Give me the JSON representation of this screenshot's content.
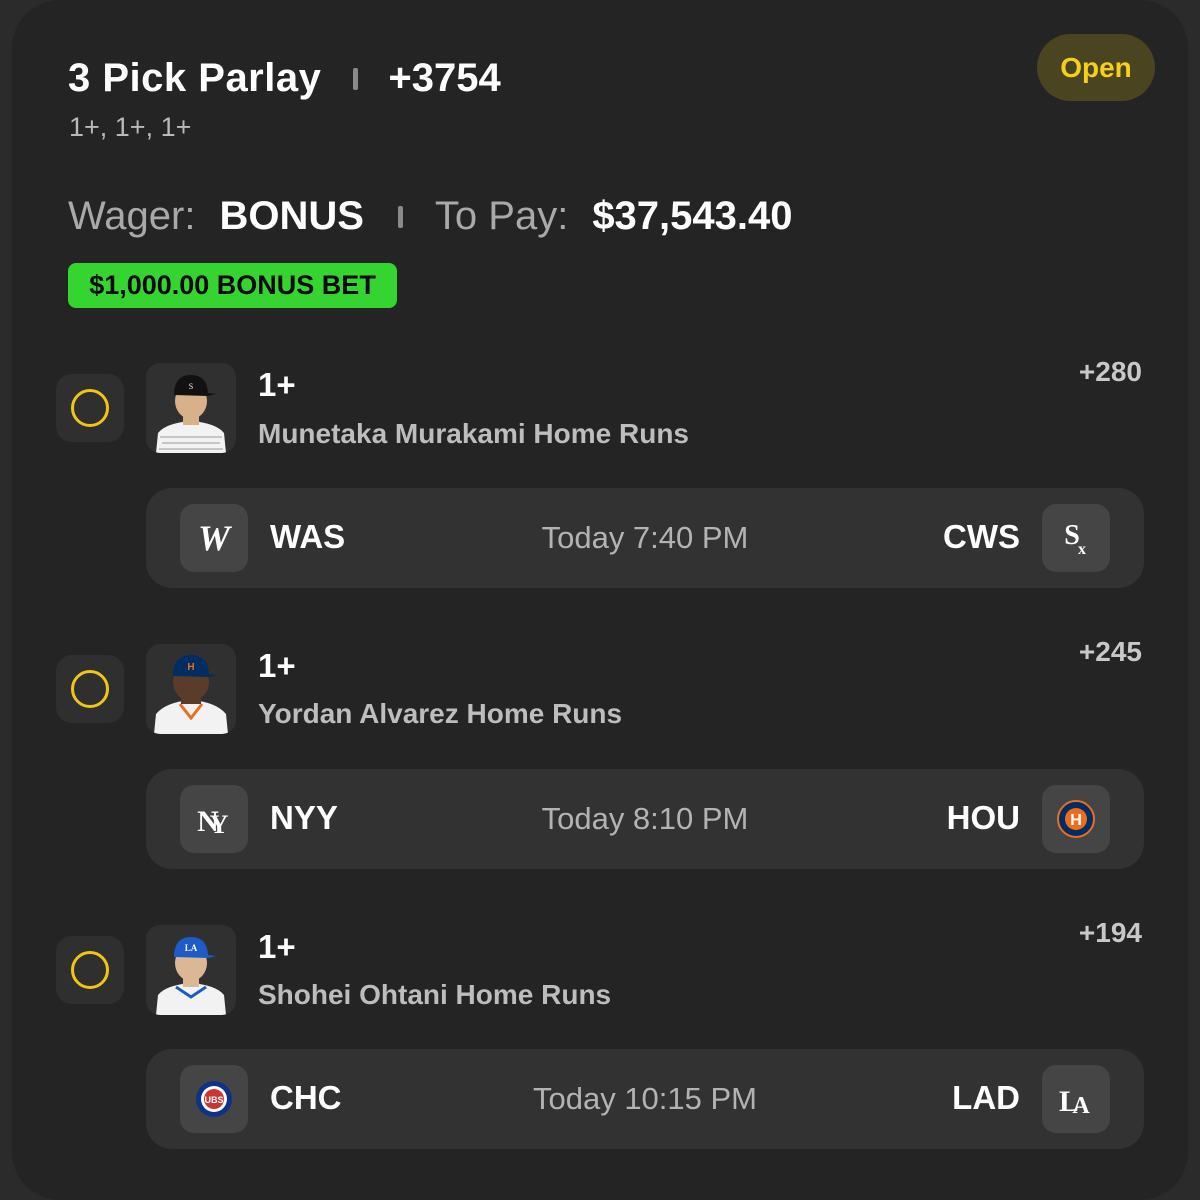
{
  "header": {
    "title": "3 Pick Parlay",
    "total_odds": "+3754",
    "subtitle": "1+, 1+, 1+",
    "status": "Open"
  },
  "wager": {
    "wager_label": "Wager:",
    "wager_value": "BONUS",
    "to_pay_label": "To Pay:",
    "to_pay_value": "$37,543.40",
    "bonus_badge": "$1,000.00 BONUS BET"
  },
  "legs": [
    {
      "line": "1+",
      "market": "Munetaka Murakami Home Runs",
      "odds": "+280",
      "away_team": "WAS",
      "home_team": "CWS",
      "time": "Today 7:40 PM",
      "away_logo_icon": "nationals-logo-icon",
      "home_logo_icon": "white-sox-logo-icon",
      "cap_color": "#111111",
      "jersey_color": "#f2f2f2",
      "skin_color": "#d8b089"
    },
    {
      "line": "1+",
      "market": "Yordan Alvarez Home Runs",
      "odds": "+245",
      "away_team": "NYY",
      "home_team": "HOU",
      "time": "Today 8:10 PM",
      "away_logo_icon": "yankees-logo-icon",
      "home_logo_icon": "astros-logo-icon",
      "cap_color": "#002d62",
      "jersey_color": "#f2f2f2",
      "skin_color": "#5b3b2a"
    },
    {
      "line": "1+",
      "market": "Shohei Ohtani Home Runs",
      "odds": "+194",
      "away_team": "CHC",
      "home_team": "LAD",
      "time": "Today 10:15 PM",
      "away_logo_icon": "cubs-logo-icon",
      "home_logo_icon": "dodgers-logo-icon",
      "cap_color": "#1e5bc6",
      "jersey_color": "#f2f2f2",
      "skin_color": "#dcb796"
    }
  ]
}
